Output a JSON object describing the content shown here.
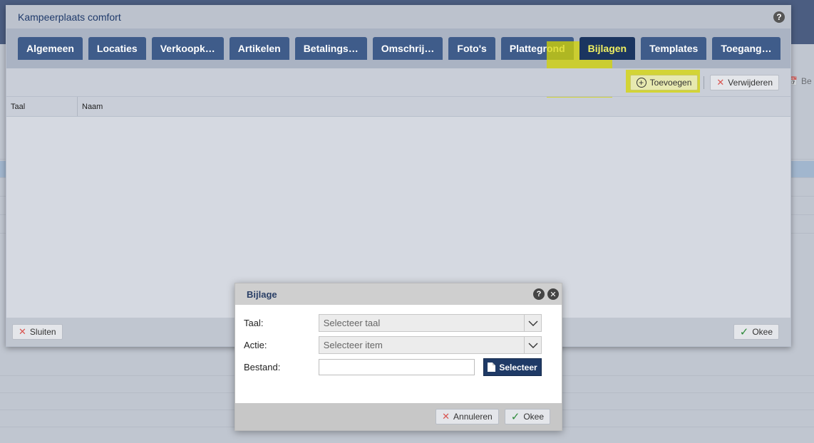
{
  "background": {
    "toolbar_partial_label": "Be"
  },
  "main_dialog": {
    "title": "Kampeerplaats comfort",
    "tabs": [
      {
        "label": "Algemeen",
        "active": false
      },
      {
        "label": "Locaties",
        "active": false
      },
      {
        "label": "Verkoopk…",
        "active": false
      },
      {
        "label": "Artikelen",
        "active": false
      },
      {
        "label": "Betalings…",
        "active": false
      },
      {
        "label": "Omschrij…",
        "active": false
      },
      {
        "label": "Foto's",
        "active": false
      },
      {
        "label": "Plattegrond",
        "active": false
      },
      {
        "label": "Bijlagen",
        "active": true
      },
      {
        "label": "Templates",
        "active": false
      },
      {
        "label": "Toegang…",
        "active": false
      }
    ],
    "toolbar": {
      "add_label": "Toevoegen",
      "delete_label": "Verwijderen"
    },
    "grid": {
      "columns": [
        "Taal",
        "Naam"
      ]
    },
    "footer": {
      "close_label": "Sluiten",
      "ok_label": "Okee"
    }
  },
  "modal": {
    "title": "Bijlage",
    "fields": {
      "taal_label": "Taal:",
      "taal_placeholder": "Selecteer taal",
      "actie_label": "Actie:",
      "actie_placeholder": "Selecteer item",
      "bestand_label": "Bestand:",
      "bestand_value": "",
      "select_file_label": "Selecteer"
    },
    "footer": {
      "cancel_label": "Annuleren",
      "ok_label": "Okee"
    }
  },
  "colors": {
    "tab_bg": "#3f5c8a",
    "tab_active_bg": "#1b3560",
    "tab_active_text": "#f1f060",
    "highlight": "#d6d600",
    "accent_dark": "#1f3a66"
  },
  "icons": [
    "help-icon",
    "plus-circle-icon",
    "close-x-icon",
    "check-icon",
    "chevron-down-icon",
    "file-icon",
    "calendar-icon"
  ]
}
